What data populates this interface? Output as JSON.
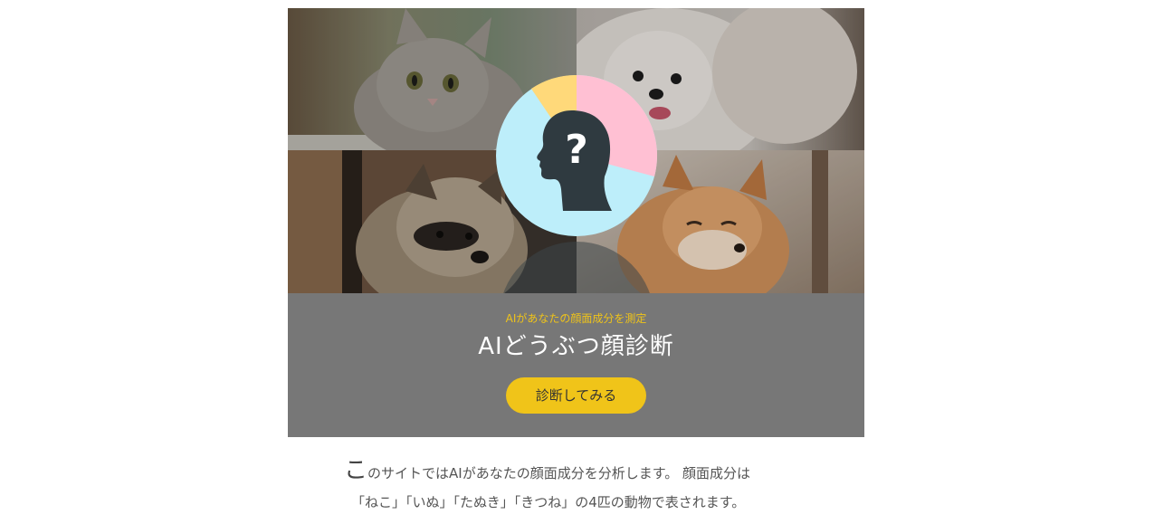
{
  "hero": {
    "tagline": "AIがあなたの顔面成分を測定",
    "title": "AIどうぶつ顔診断",
    "cta_label": "診断してみる",
    "photos": [
      "cat-photo",
      "dog-photo",
      "raccoon-dog-photo",
      "fox-photo"
    ],
    "emblem_colors": {
      "light_blue": "#bdeefa",
      "pink": "#ffc0d3",
      "yellow": "#ffd97a",
      "silhouette": "#2f3a40"
    }
  },
  "intro": {
    "dropcap": "こ",
    "line1_rest": "のサイトではAIがあなたの顔面成分を分析します。 顔面成分は",
    "line2": "「ねこ」「いぬ」「たぬき」「きつね」の4匹の動物で表されます。"
  },
  "colors": {
    "panel_bg": "#777777",
    "accent": "#f0c419"
  }
}
